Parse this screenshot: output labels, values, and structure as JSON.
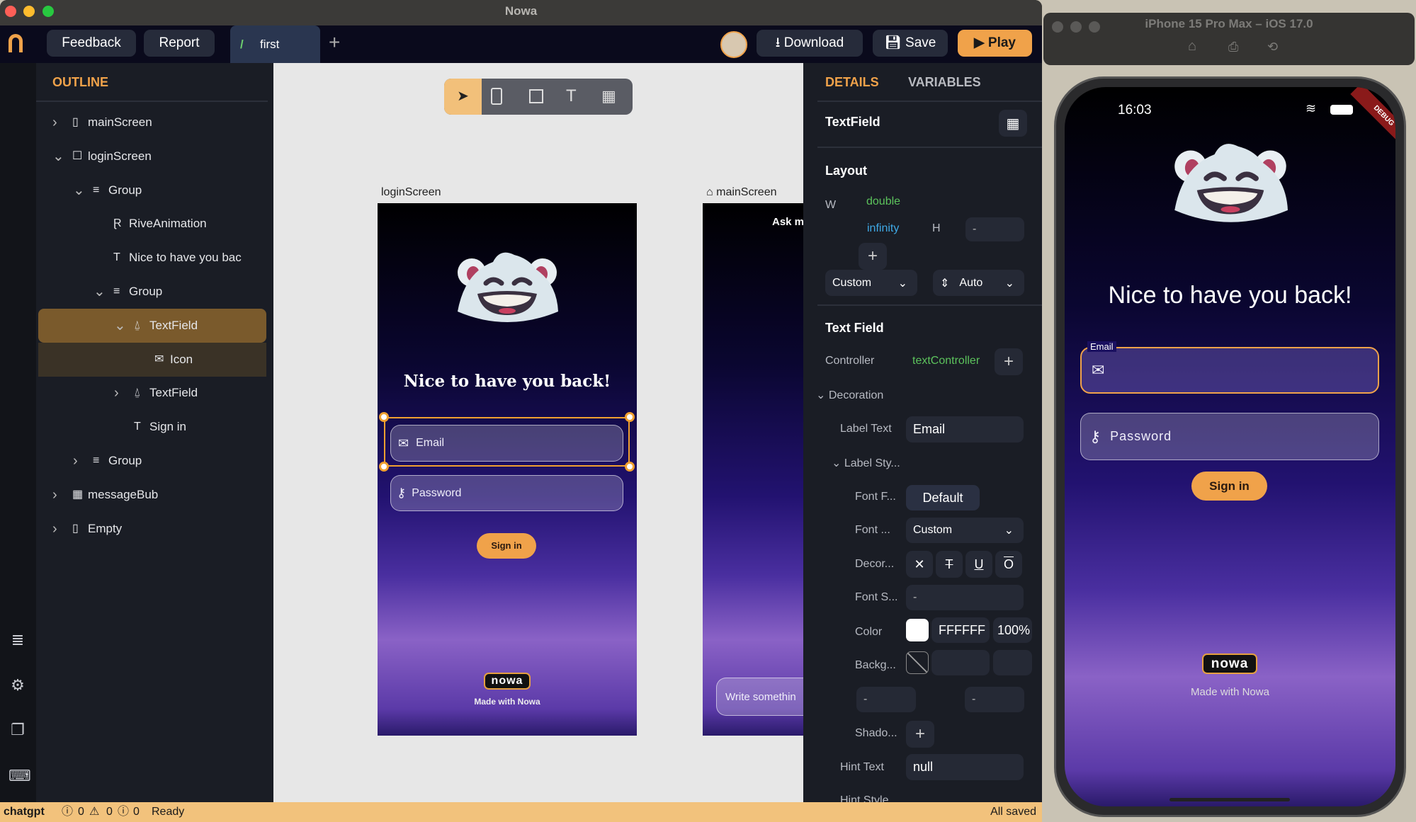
{
  "window": {
    "title": "Nowa"
  },
  "toolbar": {
    "feedback": "Feedback",
    "report": "Report",
    "tab": "first",
    "add_tab": "+",
    "download": "Download",
    "save": "Save",
    "play": "Play"
  },
  "outline": {
    "title": "OUTLINE",
    "items": [
      {
        "label": "mainScreen",
        "level": 0,
        "chevron": "right",
        "icon": "phone-icon",
        "glyph": "▯"
      },
      {
        "label": "loginScreen",
        "level": 0,
        "chevron": "down",
        "icon": "square-icon",
        "glyph": "☐"
      },
      {
        "label": "Group",
        "level": 1,
        "chevron": "down",
        "icon": "list-icon",
        "glyph": "≡"
      },
      {
        "label": "RiveAnimation",
        "level": 2,
        "chevron": "",
        "icon": "rive-icon",
        "glyph": "Ɽ"
      },
      {
        "label": "Nice to have you bac",
        "level": 2,
        "chevron": "",
        "icon": "text-icon",
        "glyph": "T"
      },
      {
        "label": "Group",
        "level": 2,
        "chevron": "down",
        "icon": "list-icon",
        "glyph": "≡"
      },
      {
        "label": "TextField",
        "level": 3,
        "chevron": "down",
        "icon": "textfield-icon",
        "glyph": "⍙",
        "selected": true
      },
      {
        "label": "Icon",
        "level": 4,
        "chevron": "",
        "icon": "mail-icon",
        "glyph": "✉",
        "child_selected": true
      },
      {
        "label": "TextField",
        "level": 3,
        "chevron": "right",
        "icon": "textfield-icon",
        "glyph": "⍙"
      },
      {
        "label": "Sign in",
        "level": 3,
        "chevron": "",
        "icon": "text-icon",
        "glyph": "T"
      },
      {
        "label": "Group",
        "level": 1,
        "chevron": "right",
        "icon": "list-icon",
        "glyph": "≡"
      },
      {
        "label": "messageBub",
        "level": 0,
        "chevron": "right",
        "icon": "grid-icon",
        "glyph": "▦"
      },
      {
        "label": "Empty",
        "level": 0,
        "chevron": "right",
        "icon": "phone-icon",
        "glyph": "▯"
      }
    ]
  },
  "canvas": {
    "login_label": "loginScreen",
    "main_label": "mainScreen",
    "login": {
      "title": "Nice to have you back!",
      "email": "Email",
      "password": "Password",
      "signin": "Sign in",
      "logo": "nowa",
      "made_with": "Made with Nowa"
    },
    "main": {
      "header": "Ask m",
      "input_placeholder": "Write somethin"
    }
  },
  "details": {
    "tabs": [
      "DETAILS",
      "VARIABLES"
    ],
    "widget": "TextField",
    "layout": {
      "title": "Layout",
      "w_label": "W",
      "w_type": "double",
      "w_value": "infinity",
      "h_label": "H",
      "h_value": "-",
      "add": "+",
      "sizing": "Custom",
      "align": "Auto"
    },
    "text_field": {
      "title": "Text Field",
      "controller_label": "Controller",
      "controller": "textController",
      "add": "+",
      "decoration": "Decoration",
      "label_text_label": "Label Text",
      "label_text": "Email",
      "label_style": "Label Sty...",
      "font_family_label": "Font F...",
      "font_family": "Default",
      "font_weight_label": "Font ...",
      "font_weight": "Custom",
      "decoration_label": "Decor...",
      "font_size_label": "Font S...",
      "font_size": "-",
      "color_label": "Color",
      "color_hex": "FFFFFF",
      "color_opacity": "100%",
      "background_label": "Backg...",
      "field_a": "-",
      "field_b": "-",
      "shadow_label": "Shado...",
      "hint_text_label": "Hint Text",
      "hint_text": "null",
      "hint_style_label": "Hint Style"
    }
  },
  "status": {
    "branch": "chatgpt",
    "errors": "0",
    "warnings": "0",
    "infos": "0",
    "state": "Ready",
    "saved": "All saved"
  },
  "simulator": {
    "title": "iPhone 15 Pro Max – iOS 17.0",
    "time": "16:03",
    "debug": "DEBUG",
    "title_text": "Nice to have you back!",
    "email_label": "Email",
    "password": "Password",
    "signin": "Sign in",
    "logo": "nowa",
    "made_with": "Made with Nowa"
  },
  "colors": {
    "accent": "#f0a24a",
    "selected_row": "#7a5a2c",
    "green": "#5cc35c",
    "blue": "#3fa9e6"
  }
}
